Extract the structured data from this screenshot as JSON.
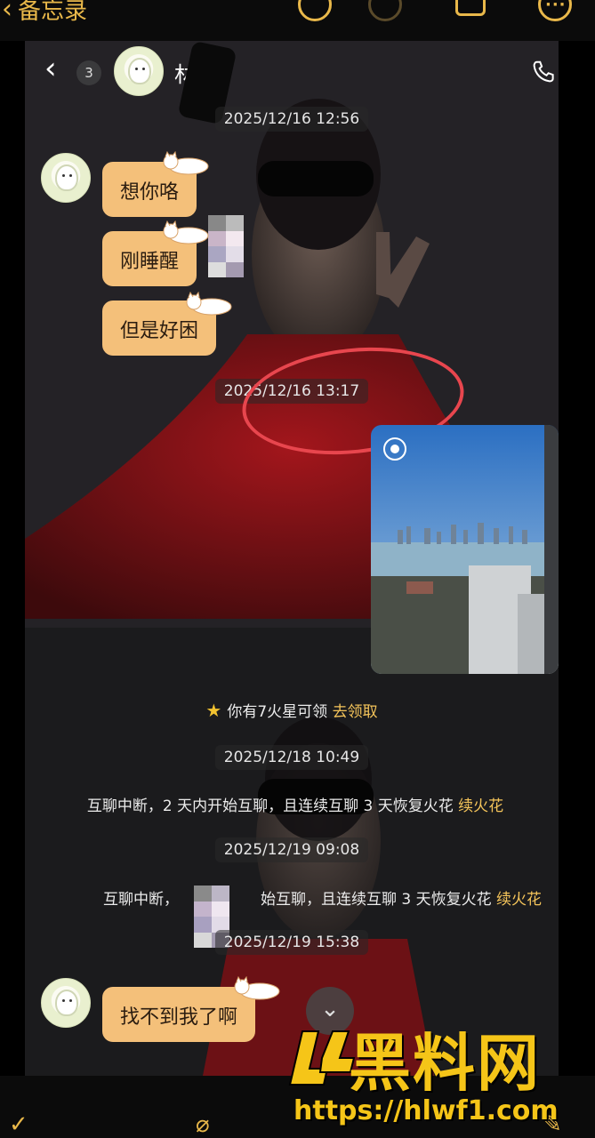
{
  "outer_app": {
    "back_label": "备忘录",
    "icons": [
      "link-icon",
      "draw-icon",
      "share-icon",
      "more-icon"
    ]
  },
  "chat": {
    "unread_count": "3",
    "contact_name": "林",
    "messages": [
      {
        "type": "timestamp",
        "text": "2025/12/16 12:56"
      },
      {
        "type": "received",
        "text": "想你咯"
      },
      {
        "type": "received",
        "text": "刚睡醒"
      },
      {
        "type": "received",
        "text": "但是好困"
      },
      {
        "type": "timestamp",
        "text": "2025/12/16 13:17"
      },
      {
        "type": "image",
        "view_once": true
      },
      {
        "type": "system",
        "text": "你有7火星可领",
        "link": "去领取"
      },
      {
        "type": "timestamp",
        "text": "2025/12/18 10:49"
      },
      {
        "type": "system",
        "text": "互聊中断，2 天内开始互聊，且连续互聊 3 天恢复火花",
        "link": "续火花"
      },
      {
        "type": "timestamp",
        "text": "2025/12/19 09:08"
      },
      {
        "type": "system",
        "text_left": "互聊中断，",
        "text_right": "始互聊，且连续互聊 3 天恢复火花",
        "link": "续火花"
      },
      {
        "type": "timestamp",
        "text": "2025/12/19 15:38"
      },
      {
        "type": "received",
        "text": "找不到我了啊"
      }
    ]
  },
  "watermark": {
    "title": "黑料网",
    "url": "https://hlwf1.com"
  },
  "colors": {
    "bubble": "#f4c07a",
    "link": "#f4c45a",
    "annotation": "#e8464e",
    "app_accent": "#e9b84a"
  }
}
